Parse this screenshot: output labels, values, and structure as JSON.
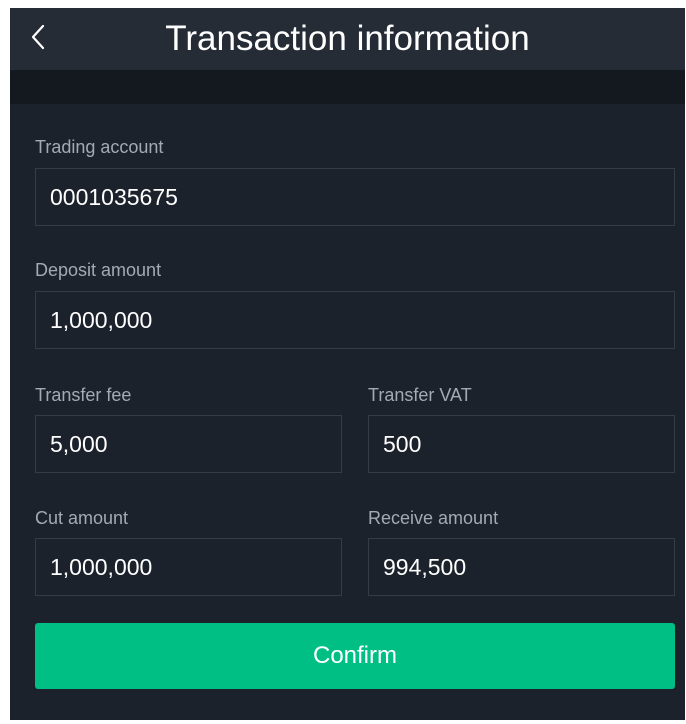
{
  "header": {
    "title": "Transaction information",
    "back_icon": "chevron-left-icon"
  },
  "form": {
    "trading_account": {
      "label": "Trading account",
      "value": "0001035675"
    },
    "deposit_amount": {
      "label": "Deposit amount",
      "value": "1,000,000"
    },
    "transfer_fee": {
      "label": "Transfer fee",
      "value": "5,000"
    },
    "transfer_vat": {
      "label": "Transfer VAT",
      "value": "500"
    },
    "cut_amount": {
      "label": "Cut amount",
      "value": "1,000,000"
    },
    "receive_amount": {
      "label": "Receive amount",
      "value": "994,500"
    }
  },
  "actions": {
    "confirm_label": "Confirm"
  },
  "colors": {
    "background": "#1c222b",
    "header": "#252c36",
    "accent": "#00bf85",
    "label": "#a3aab4"
  }
}
